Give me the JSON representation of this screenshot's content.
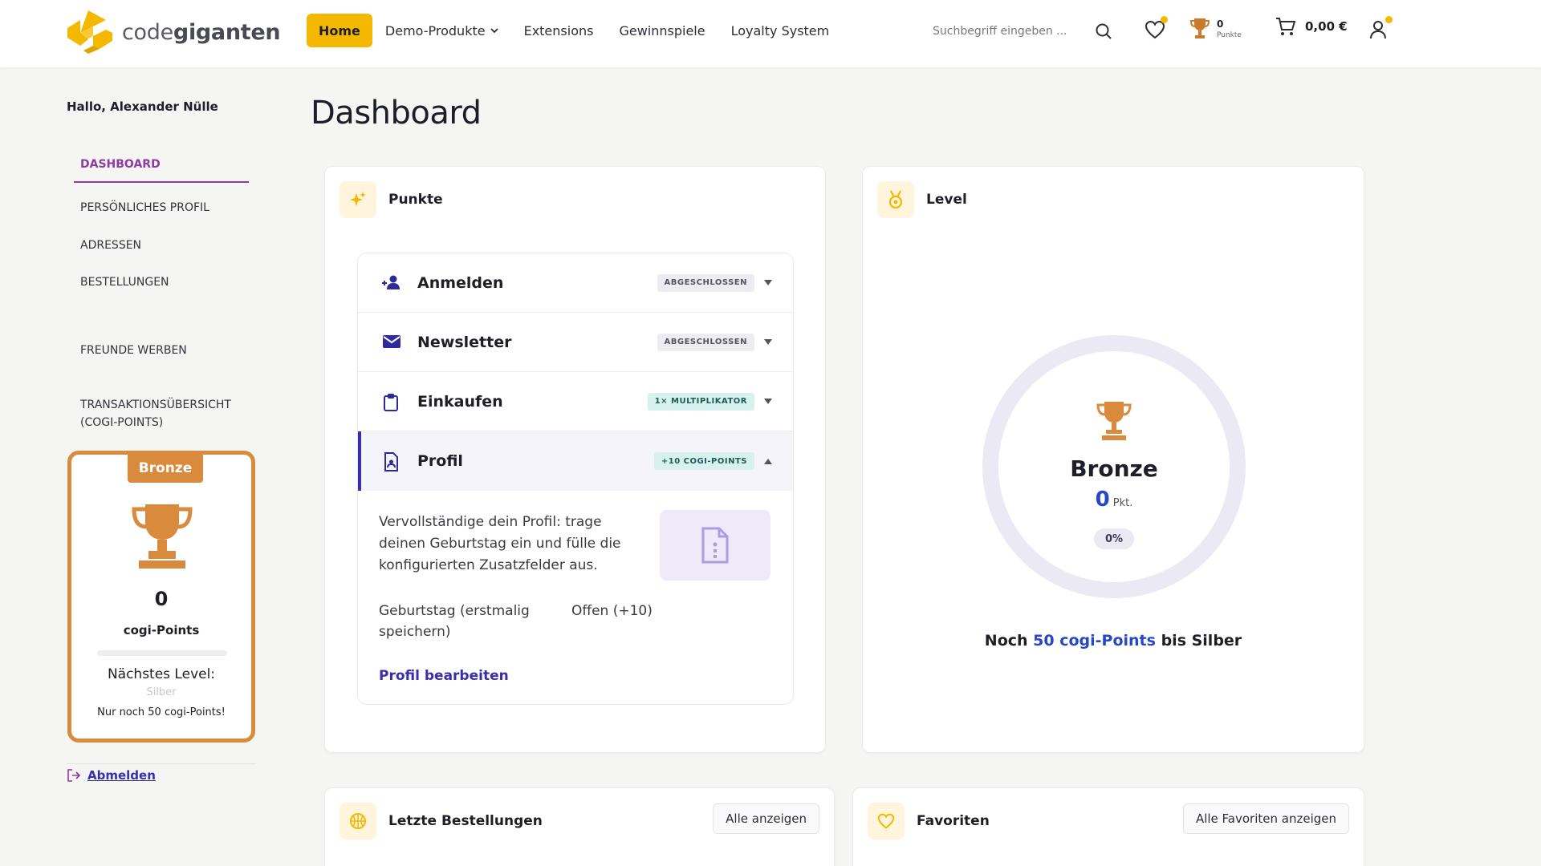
{
  "header": {
    "logo": {
      "text_light": "code",
      "text_bold": "giganten"
    },
    "nav": [
      {
        "label": "Home",
        "active": true
      },
      {
        "label": "Demo-Produkte",
        "dropdown": true
      },
      {
        "label": "Extensions"
      },
      {
        "label": "Gewinnspiele"
      },
      {
        "label": "Loyalty System"
      }
    ],
    "search": {
      "placeholder": "Suchbegriff eingeben ..."
    },
    "points": {
      "value": "0",
      "label": "Punkte"
    },
    "cart": {
      "total": "0,00 €"
    },
    "icons": [
      "search-icon",
      "heart-icon",
      "trophy-icon",
      "cart-icon",
      "user-icon"
    ]
  },
  "sidebar": {
    "greeting": "Hallo, Alexander Nülle",
    "items": [
      {
        "label": "Dashboard",
        "active": true
      },
      {
        "label": "Persönliches Profil"
      },
      {
        "label": "Adressen"
      },
      {
        "label": "Bestellungen"
      },
      {
        "label": "Freunde werben"
      },
      {
        "label": "Transaktionsübersicht (cogi-Points)"
      }
    ],
    "level_card": {
      "badge": "Bronze",
      "points": "0",
      "points_label": "cogi-Points",
      "progress": 0,
      "next_level_label": "Nächstes Level:",
      "next_level_name": "Silber",
      "remaining": "Nur noch 50 cogi-Points!"
    },
    "logout": "Abmelden"
  },
  "main": {
    "title": "Dashboard",
    "punkte": {
      "title": "Punkte",
      "rows": [
        {
          "label": "Anmelden",
          "badge": "ABGESCHLOSSEN",
          "badge_style": "grey",
          "icon": "user-add-icon"
        },
        {
          "label": "Newsletter",
          "badge": "ABGESCHLOSSEN",
          "badge_style": "grey",
          "icon": "mail-icon"
        },
        {
          "label": "Einkaufen",
          "badge": "1× MULTIPLIKATOR",
          "badge_style": "teal",
          "icon": "clipboard-icon"
        },
        {
          "label": "Profil",
          "badge": "+10 COGI-POINTS",
          "badge_style": "teal",
          "icon": "profile-document-icon",
          "open": true
        }
      ],
      "profil_detail": {
        "description": "Vervollständige dein Profil: trage deinen Geburtstag ein und fülle die konfigurierten Zusatzfelder aus.",
        "task": "Geburtstag (erstmalig speichern)",
        "status": "Offen (+10)",
        "link": "Profil bearbeiten"
      }
    },
    "level": {
      "title": "Level",
      "name": "Bronze",
      "points": "0",
      "points_unit": "Pkt.",
      "percent": "0%",
      "progress": 0,
      "next_prefix": "Noch",
      "next_highlight": "50 cogi-Points",
      "next_suffix": "bis Silber"
    },
    "orders": {
      "title": "Letzte Bestellungen",
      "button": "Alle anzeigen"
    },
    "favorites": {
      "title": "Favoriten",
      "button": "Alle Favoriten anzeigen"
    }
  },
  "colors": {
    "accent": "#f5b800",
    "bronze": "#d98a3d",
    "link": "#3a2fa8",
    "highlight": "#2747c8"
  }
}
